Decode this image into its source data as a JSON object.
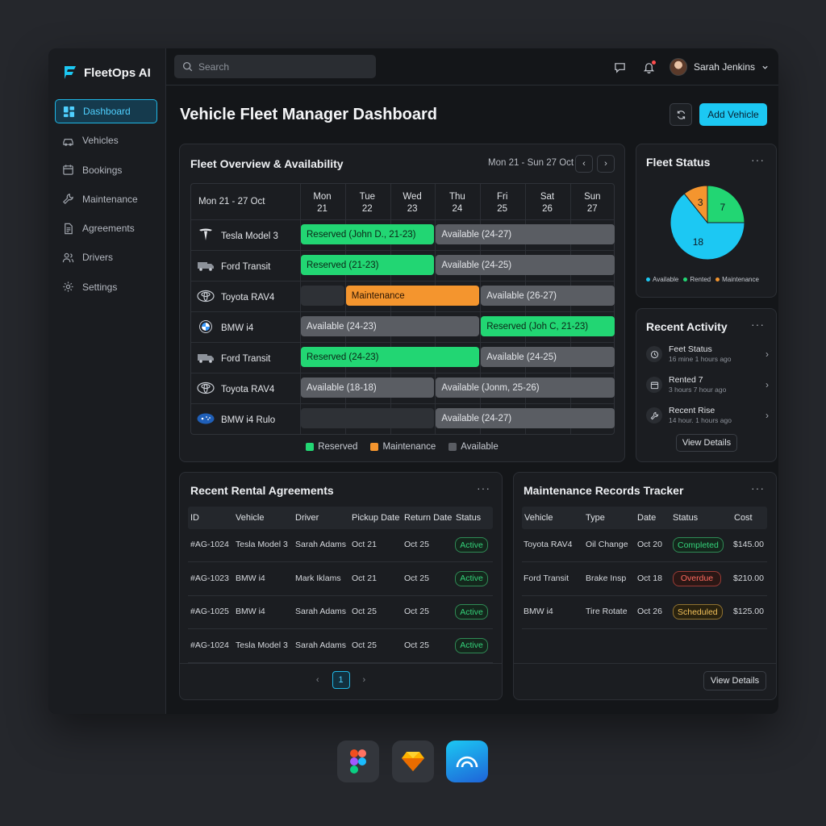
{
  "app": {
    "name": "FleetOps AI"
  },
  "sidebar": {
    "items": [
      {
        "label": "Dashboard",
        "icon": "dashboard-icon",
        "active": true
      },
      {
        "label": "Vehicles",
        "icon": "car-icon"
      },
      {
        "label": "Bookings",
        "icon": "calendar-icon"
      },
      {
        "label": "Maintenance",
        "icon": "wrench-icon"
      },
      {
        "label": "Agreements",
        "icon": "document-icon"
      },
      {
        "label": "Drivers",
        "icon": "users-icon"
      },
      {
        "label": "Settings",
        "icon": "gear-icon"
      }
    ]
  },
  "topbar": {
    "search_placeholder": "Search",
    "user_name": "Sarah Jenkins"
  },
  "page": {
    "title": "Vehicle Fleet Manager Dashboard",
    "add_button": "Add Vehicle"
  },
  "overview": {
    "title": "Fleet Overview & Availability",
    "range": "Mon 21 - Sun 27 Oct",
    "grid_label": "Mon 21 - 27 Oct",
    "days": [
      {
        "name": "Mon",
        "date": "21"
      },
      {
        "name": "Tue",
        "date": "22"
      },
      {
        "name": "Wed",
        "date": "23"
      },
      {
        "name": "Thu",
        "date": "24"
      },
      {
        "name": "Fri",
        "date": "25"
      },
      {
        "name": "Sat",
        "date": "26"
      },
      {
        "name": "Sun",
        "date": "27"
      }
    ],
    "rows": [
      {
        "vehicle": "Tesla Model 3",
        "icon": "tesla-logo-icon",
        "bars": [
          {
            "start": 0,
            "end": 3,
            "type": "reserved",
            "label": "Reserved (John D., 21-23)"
          },
          {
            "start": 3,
            "end": 7,
            "type": "available",
            "label": "Available (24-27)"
          }
        ]
      },
      {
        "vehicle": "Ford Transit",
        "icon": "van-icon",
        "bars": [
          {
            "start": 0,
            "end": 3,
            "type": "reserved",
            "label": "Reserved (21-23)"
          },
          {
            "start": 3,
            "end": 7,
            "type": "available",
            "label": "Available (24-25)"
          }
        ]
      },
      {
        "vehicle": "Toyota RAV4",
        "icon": "toyota-logo-icon",
        "bars": [
          {
            "start": 0,
            "end": 1,
            "type": "empty",
            "label": ""
          },
          {
            "start": 1,
            "end": 4,
            "type": "maintenance",
            "label": "Maintenance"
          },
          {
            "start": 4,
            "end": 7,
            "type": "available",
            "label": "Available (26-27)"
          }
        ]
      },
      {
        "vehicle": "BMW i4",
        "icon": "bmw-logo-icon",
        "bars": [
          {
            "start": 0,
            "end": 4,
            "type": "available",
            "label": "Available (24-23)"
          },
          {
            "start": 4,
            "end": 7,
            "type": "reserved",
            "label": "Reserved (Joh C, 21-23)"
          }
        ]
      },
      {
        "vehicle": "Ford Transit",
        "icon": "van-icon",
        "bars": [
          {
            "start": 0,
            "end": 4,
            "type": "reserved",
            "label": "Reserved (24-23)"
          },
          {
            "start": 4,
            "end": 7,
            "type": "available",
            "label": "Available (24-25)"
          }
        ]
      },
      {
        "vehicle": "Toyota RAV4",
        "icon": "toyota-logo-icon",
        "bars": [
          {
            "start": 0,
            "end": 3,
            "type": "available",
            "label": "Available (18-18)"
          },
          {
            "start": 3,
            "end": 7,
            "type": "available",
            "label": "Available (Jonm, 25-26)"
          }
        ]
      },
      {
        "vehicle": "BMW i4 Rulo",
        "icon": "subaru-logo-icon",
        "bars": [
          {
            "start": 0,
            "end": 3,
            "type": "empty",
            "label": ""
          },
          {
            "start": 3,
            "end": 7,
            "type": "available",
            "label": "Available (24-27)"
          }
        ]
      }
    ],
    "legend": [
      {
        "label": "Reserved",
        "color": "#22d673"
      },
      {
        "label": "Maintenance",
        "color": "#f4952e"
      },
      {
        "label": "Available",
        "color": "#5a5d63"
      }
    ]
  },
  "fleet_status": {
    "title": "Fleet Status",
    "slices": [
      {
        "label": "Available",
        "value": 18,
        "color": "#1cc8f3"
      },
      {
        "label": "Rented",
        "value": 7,
        "color": "#22d673"
      },
      {
        "label": "Maintenance",
        "value": 3,
        "color": "#f4952e"
      }
    ]
  },
  "activity": {
    "title": "Recent Activity",
    "items": [
      {
        "title": "Feet Status",
        "sub": "16 mine 1 hours ago",
        "icon": "clock-icon"
      },
      {
        "title": "Rented 7",
        "sub": "3 hours  7 hour ago",
        "icon": "calendar-icon"
      },
      {
        "title": "Recent Rise",
        "sub": "14 hour. 1 hours ago",
        "icon": "wrench-icon"
      }
    ],
    "button": "View Details"
  },
  "agreements": {
    "title": "Recent Rental Agreements",
    "columns": [
      "ID",
      "Vehicle",
      "Driver",
      "Pickup Date",
      "Return Date",
      "Status"
    ],
    "rows": [
      [
        "#AG-1024",
        "Tesla Model 3",
        "Sarah Adams",
        "Oct 21",
        "Oct 25",
        "Active"
      ],
      [
        "#AG-1023",
        "BMW i4",
        "Mark Iklams",
        "Oct 21",
        "Oct 25",
        "Active"
      ],
      [
        "#AG-1025",
        "BMW i4",
        "Sarah Adams",
        "Oct 25",
        "Oct 25",
        "Active"
      ],
      [
        "#AG-1024",
        "Tesla Model 3",
        "Sarah Adams",
        "Oct 25",
        "Oct 25",
        "Active"
      ]
    ],
    "page": "1"
  },
  "maintenance": {
    "title": "Maintenance Records Tracker",
    "columns": [
      "Vehicle",
      "Type",
      "Date",
      "Status",
      "Cost"
    ],
    "rows": [
      [
        "Toyota RAV4",
        "Oil Change",
        "Oct 20",
        "Completed",
        "$145.00"
      ],
      [
        "Ford Transit",
        "Brake Insp",
        "Oct 18",
        "Overdue",
        "$210.00"
      ],
      [
        "BMW i4",
        "Tire Rotate",
        "Oct 26",
        "Scheduled",
        "$125.00"
      ]
    ],
    "button": "View Details"
  },
  "dock": [
    {
      "icon": "figma-icon"
    },
    {
      "icon": "sketch-icon"
    },
    {
      "icon": "app-icon"
    }
  ]
}
